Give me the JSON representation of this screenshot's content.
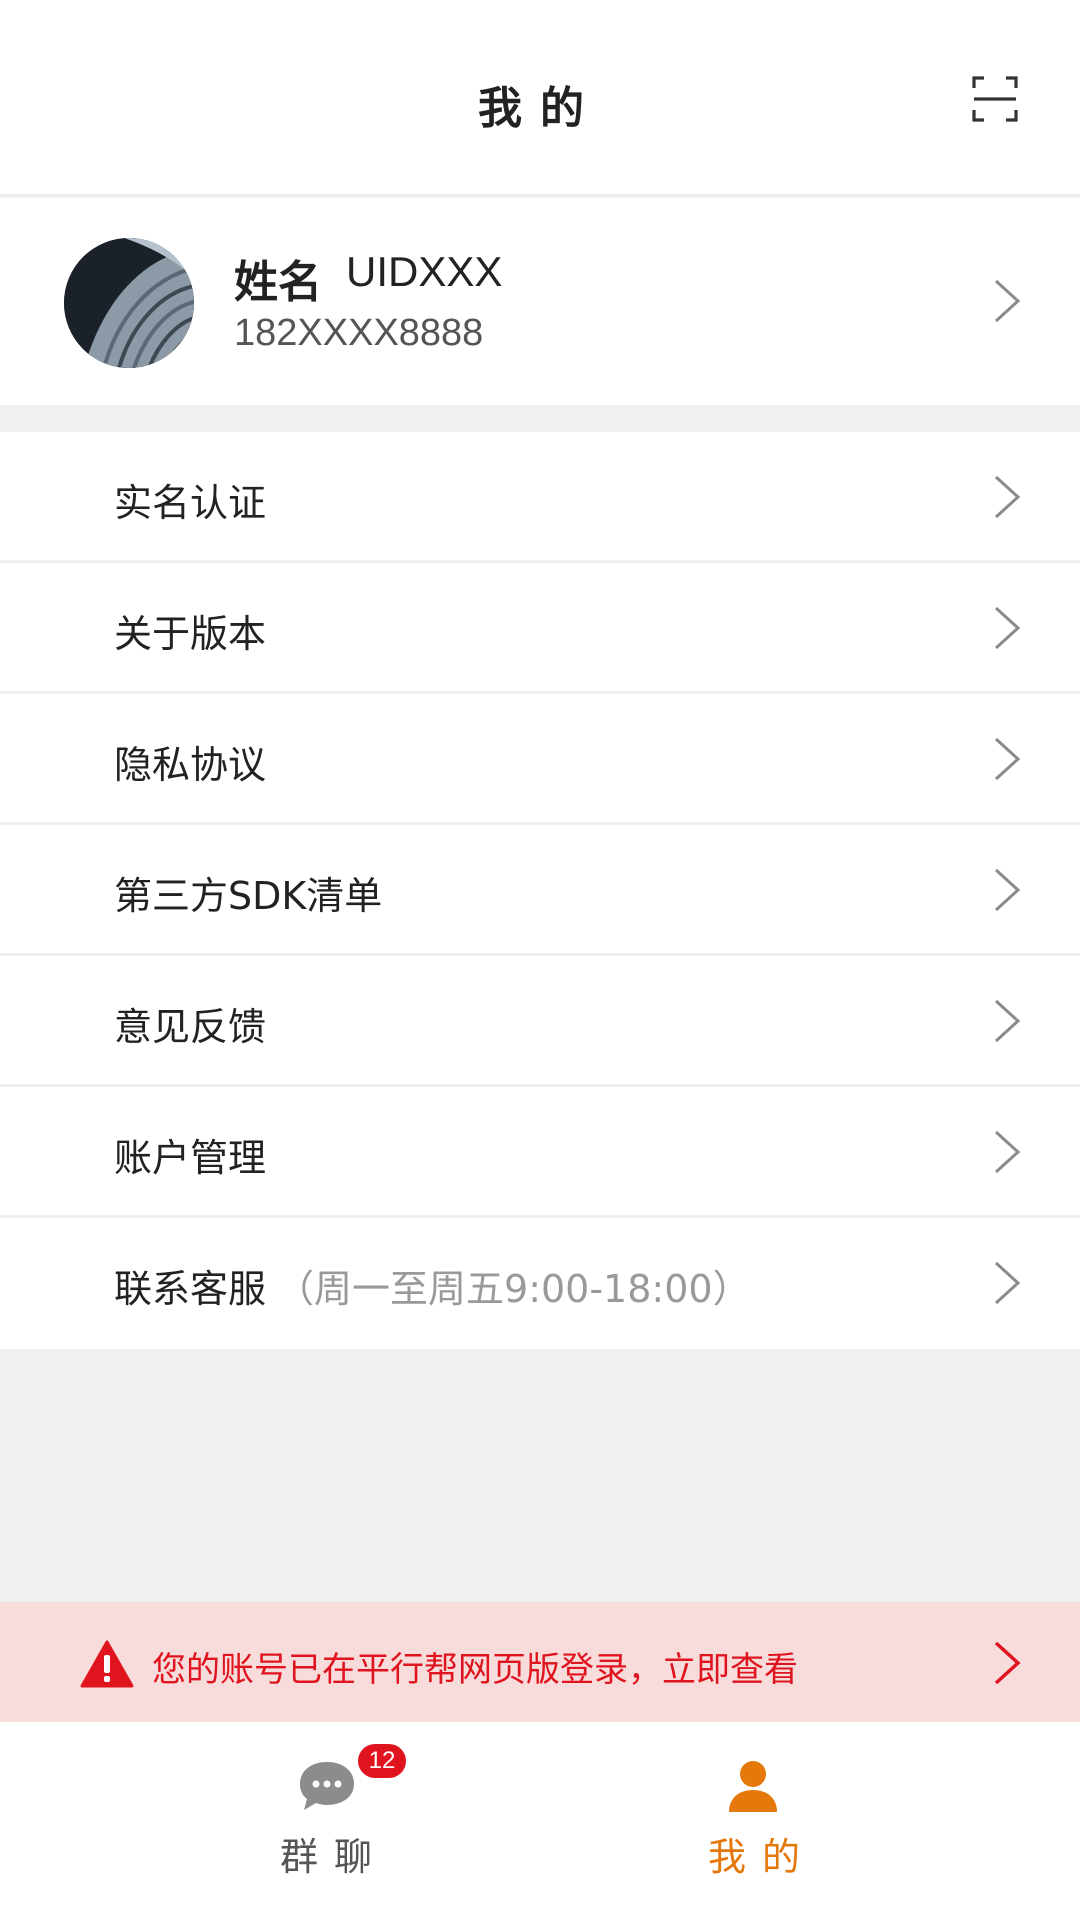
{
  "header": {
    "title": "我的",
    "scan_icon": "scan-icon"
  },
  "profile": {
    "name": "姓名",
    "uid": "UIDXXX",
    "phone": "182XXXX8888"
  },
  "menu": {
    "items": [
      {
        "label": "实名认证",
        "note": ""
      },
      {
        "label": "关于版本",
        "note": ""
      },
      {
        "label": "隐私协议",
        "note": ""
      },
      {
        "label": "第三方SDK清单",
        "note": ""
      },
      {
        "label": "意见反馈",
        "note": ""
      },
      {
        "label": "账户管理",
        "note": ""
      },
      {
        "label": "联系客服",
        "note": "（周一至周五9:00-18:00）"
      }
    ]
  },
  "alert": {
    "text": "您的账号已在平行帮网页版登录，立即查看",
    "color": "#e0141e",
    "icon": "warning-icon"
  },
  "tabbar": {
    "tabs": [
      {
        "label": "群聊",
        "badge": "12",
        "icon": "chat-icon",
        "active": false
      },
      {
        "label": "我的",
        "icon": "user-icon",
        "active": true
      }
    ],
    "active_color": "#e4780a"
  }
}
